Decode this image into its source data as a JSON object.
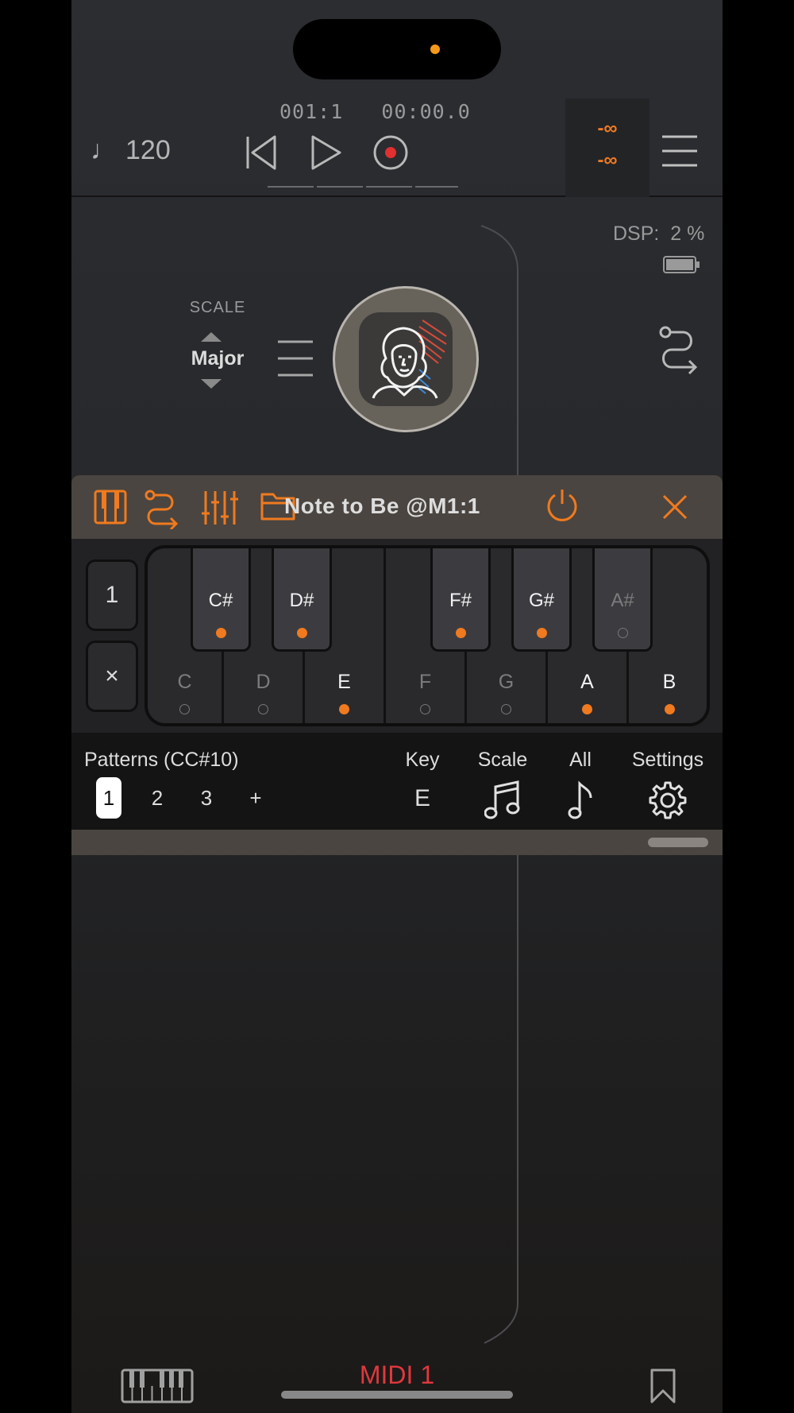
{
  "status": {
    "island": "dynamic-island"
  },
  "transport": {
    "tempo": "120",
    "tempo_icon": "♩",
    "position": "001:1   00:00.0",
    "rewind_icon": "rewind-icon",
    "play_icon": "play-icon",
    "record_icon": "record-icon",
    "meter_top": "-∞",
    "meter_bottom": "-∞",
    "menu_icon": "hamburger-menu-icon"
  },
  "rack": {
    "dsp": "DSP:  2 %",
    "scale_label": "SCALE",
    "scale_value": "Major",
    "plugin_icon": "composer-portrait-icon"
  },
  "plugin": {
    "title": "Note to Be @M1:1",
    "tabs": [
      "keyboard-icon",
      "routing-icon",
      "mixer-icon",
      "folder-icon"
    ],
    "power_icon": "power-icon",
    "close_icon": "close-icon",
    "side_buttons": {
      "pattern_index": "1",
      "clear": "×"
    },
    "white_keys": [
      {
        "label": "C",
        "active": false
      },
      {
        "label": "D",
        "active": false
      },
      {
        "label": "E",
        "active": true
      },
      {
        "label": "F",
        "active": false
      },
      {
        "label": "G",
        "active": false
      },
      {
        "label": "A",
        "active": true
      },
      {
        "label": "B",
        "active": true
      }
    ],
    "black_keys": [
      {
        "label": "C#",
        "active": true
      },
      {
        "label": "D#",
        "active": true
      },
      {
        "label": "F#",
        "active": true
      },
      {
        "label": "G#",
        "active": true
      },
      {
        "label": "A#",
        "active": false
      }
    ],
    "patterns_label": "Patterns (CC#10)",
    "patterns": [
      "1",
      "2",
      "3",
      "+"
    ],
    "selected_pattern": "1",
    "key_label": "Key",
    "key_value": "E",
    "scale_label": "Scale",
    "all_label": "All",
    "settings_label": "Settings"
  },
  "bottom": {
    "track_name": "MIDI 1",
    "piano_icon": "piano-keys-icon",
    "bookmark_icon": "bookmark-icon"
  },
  "colors": {
    "accent": "#f07a1f",
    "track": "#e0383e",
    "panel": "#4a4540"
  }
}
